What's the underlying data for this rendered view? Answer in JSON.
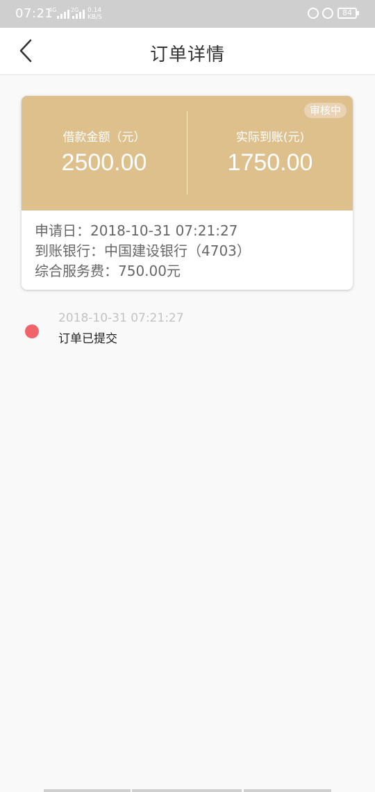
{
  "status_bar": {
    "time": "07:21",
    "net_1": "4G",
    "net_2": "2G",
    "speed_value": "0.14",
    "speed_unit": "KB/S",
    "battery": "84"
  },
  "nav": {
    "title": "订单详情"
  },
  "order_card": {
    "status_badge": "审核中",
    "loan_amount_label": "借款金额（元）",
    "loan_amount": "2500.00",
    "received_label": "实际到账(元)",
    "received_amount": "1750.00",
    "apply_date": "申请日：2018-10-31 07:21:27",
    "bank": "到账银行：中国建设银行（4703）",
    "service_fee": "综合服务费：750.00元"
  },
  "timeline": [
    {
      "time": "2018-10-31 07:21:27",
      "status": "订单已提交"
    }
  ],
  "colors": {
    "card_header": "#ddc08b",
    "badge": "#ead2b4",
    "timeline_dot": "#f0636b",
    "background": "#f9f9f9"
  }
}
